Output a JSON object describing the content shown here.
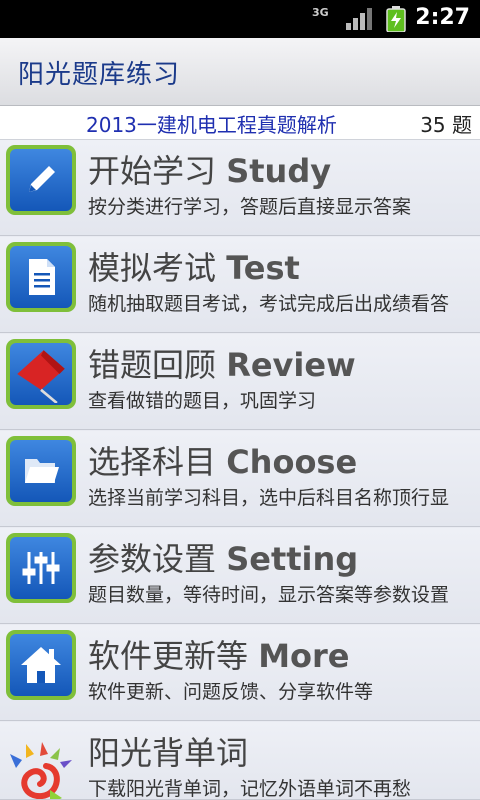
{
  "status_bar": {
    "network": "3G",
    "time": "2:27"
  },
  "app": {
    "title": "阳光题库练习"
  },
  "subject": {
    "name": "2013一建机电工程真题解析",
    "count": "35 题"
  },
  "menu": [
    {
      "title_cn": "开始学习 ",
      "title_en": "Study",
      "desc": "按分类进行学习，答题后直接显示答案",
      "icon": "pencil-icon"
    },
    {
      "title_cn": "模拟考试 ",
      "title_en": "Test",
      "desc": "随机抽取题目考试，考试完成后出成绩看答",
      "icon": "document-icon"
    },
    {
      "title_cn": "错题回顾 ",
      "title_en": "Review",
      "desc": "查看做错的题目，巩固学习",
      "icon": "flag-icon"
    },
    {
      "title_cn": "选择科目 ",
      "title_en": "Choose",
      "desc": "选择当前学习科目，选中后科目名称顶行显",
      "icon": "folder-icon"
    },
    {
      "title_cn": "参数设置 ",
      "title_en": "Setting",
      "desc": "题目数量，等待时间，显示答案等参数设置",
      "icon": "sliders-icon"
    },
    {
      "title_cn": "软件更新等 ",
      "title_en": "More",
      "desc": "软件更新、问题反馈、分享软件等",
      "icon": "home-icon"
    },
    {
      "title_cn": "阳光背单词",
      "title_en": "",
      "desc": "下载阳光背单词，记忆外语单词不再愁",
      "icon": "sunshine-logo-icon"
    }
  ]
}
